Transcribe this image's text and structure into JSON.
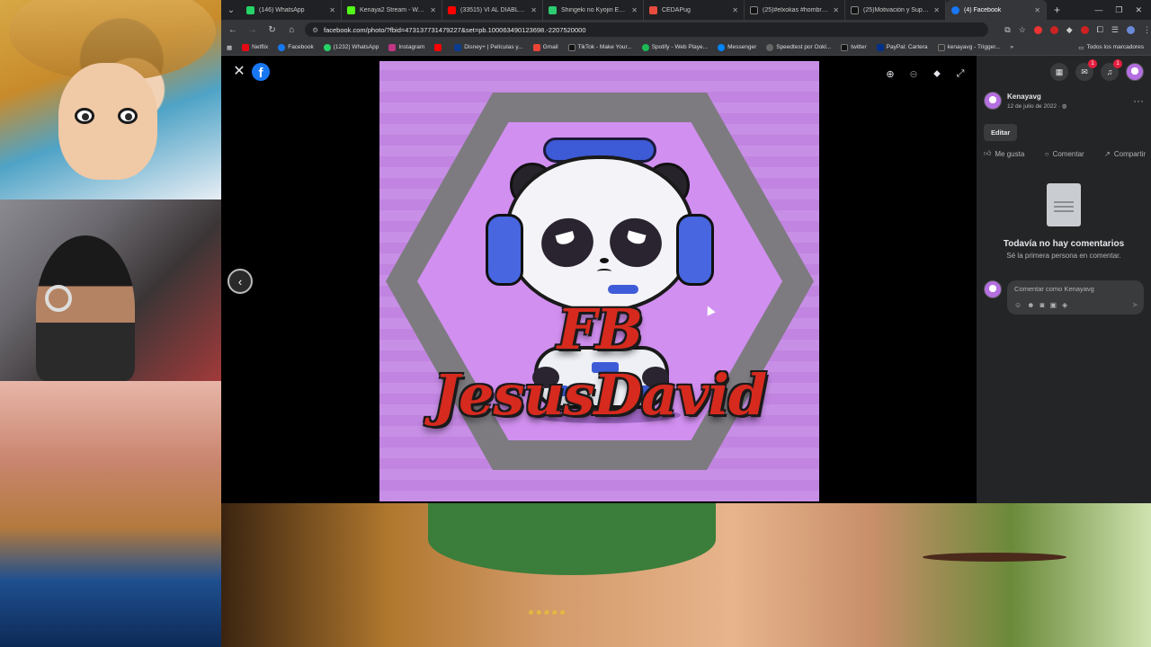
{
  "browser": {
    "tabs": [
      {
        "label": "(146) WhatsApp",
        "color": "#25d366"
      },
      {
        "label": "Kenaya2 Stream - Watch",
        "color": "#53fc18"
      },
      {
        "label": "(33515) VI AL DIABLO...",
        "color": "#ff0000"
      },
      {
        "label": "Shingeki no Kyojin Episo",
        "color": "#2ecc71"
      },
      {
        "label": "CEDAPug",
        "color": "#e74c3c"
      },
      {
        "label": "(25)#elxokas #hombres #",
        "color": "#111111"
      },
      {
        "label": "(25)Motivación y Supera",
        "color": "#111111"
      },
      {
        "label": "(4) Facebook",
        "color": "#1877f2",
        "active": true
      }
    ],
    "url": "facebook.com/photo/?fbid=473137731479227&set=pb.100063490123698.-2207520000",
    "bookmarks": [
      {
        "label": "Netflix",
        "color": "#e50914"
      },
      {
        "label": "Facebook",
        "color": "#1877f2"
      },
      {
        "label": "(1232) WhatsApp",
        "color": "#25d366"
      },
      {
        "label": "Instagram",
        "color": "#c13584"
      },
      {
        "label": "",
        "color": "#ff0000"
      },
      {
        "label": "Disney+ | Películas y...",
        "color": "#0a3d8f"
      },
      {
        "label": "Gmail",
        "color": "#ea4335"
      },
      {
        "label": "TikTok - Make Your...",
        "color": "#111111"
      },
      {
        "label": "Spotify - Web Playe...",
        "color": "#1db954"
      },
      {
        "label": "Messenger",
        "color": "#0084ff"
      },
      {
        "label": "Speedtest por Ookl...",
        "color": "#666666"
      },
      {
        "label": "twitter",
        "color": "#111111"
      },
      {
        "label": "PayPal: Cartera",
        "color": "#003087"
      },
      {
        "label": "kenayavg - Trigger...",
        "color": "#333333"
      }
    ],
    "bookmarks_folder": "Todos los marcadores"
  },
  "photo": {
    "logo_text": "FB JesusDavid"
  },
  "post": {
    "author": "Kenayavg",
    "date": "12 de julio de 2022 ·",
    "edit_label": "Editar",
    "actions": {
      "like": "Me gusta",
      "comment": "Comentar",
      "share": "Compartir"
    },
    "no_comments_title": "Todavía no hay comentarios",
    "no_comments_sub": "Sé la primera persona en comentar.",
    "comment_placeholder": "Comentar como Kenayavg"
  },
  "notifications": {
    "messenger_badge": "1",
    "bell_badge": "1"
  },
  "colors": {
    "facebook_blue": "#1877f2",
    "panel_bg": "#242526",
    "logo_red": "#d62a1e"
  }
}
